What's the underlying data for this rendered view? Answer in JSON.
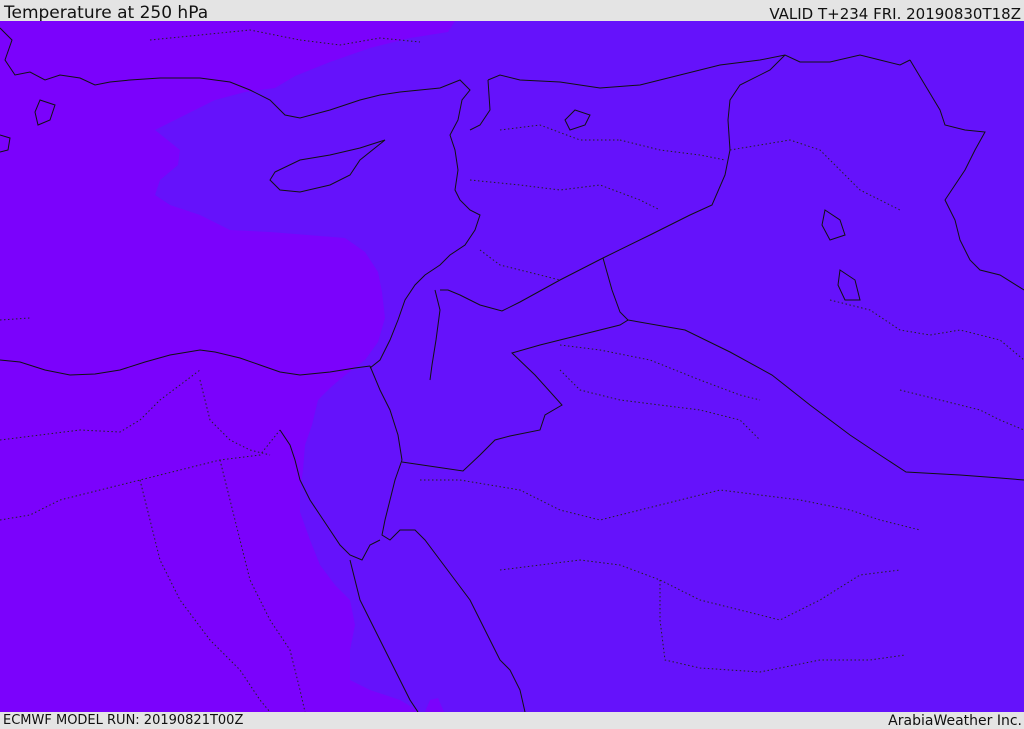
{
  "header": {
    "title": "Temperature at 250 hPa",
    "valid": "VALID T+234 FRI. 20190830T18Z"
  },
  "footer": {
    "model_run": "ECMWF MODEL RUN: 20190821T00Z",
    "credit": "ArabiaWeather Inc."
  },
  "map": {
    "field": "Temperature",
    "level": "250 hPa",
    "colors": {
      "warmer_band": "#7b02fc",
      "cooler_band": "#6512fb",
      "border_lines": "#111111"
    }
  }
}
